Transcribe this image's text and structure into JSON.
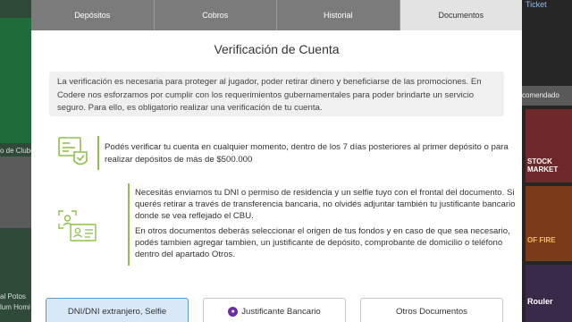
{
  "background": {
    "ticket_label": "Ticket",
    "left_text_top": "o de Clubes",
    "left_text_bottom": [
      "al Potos",
      "lum Homi"
    ],
    "right_rec_label": "comendado",
    "game1_label": "STOCK MARKET",
    "game2_label": "OF FIRE",
    "game3_label": "Rouler"
  },
  "tabs": [
    {
      "label": "Depósitos",
      "active": false
    },
    {
      "label": "Cobros",
      "active": false
    },
    {
      "label": "Historial",
      "active": false
    },
    {
      "label": "Documentos",
      "active": true
    }
  ],
  "title": "Verificación de Cuenta",
  "info_text": "La verificación es necesaria para proteger al jugador, poder retirar dinero y beneficiarse de las promociones. En Codere nos esforzamos por cumplir con los requerimientos gubernamentales para poder brindarte un servicio seguro. Para ello, es obligatorio realizar una verificación de tu cuenta.",
  "block1_text": "Podés verificar tu cuenta en cualquier momento, dentro de los 7 días posteriores al primer depósito o para realizar depósitos de más de $500.000",
  "block2_p1": "Necesitás enviarnos tu DNI o permiso de residencia y un selfie tuyo con el frontal del documento. Si querés retirar a través de transferencia bancaria, no olvidés adjuntar también tu justificante bancario donde se vea reflejado el CBU.",
  "block2_p2": "En otros documentos deberás seleccionar el origen de tus fondos y en caso de que sea necesario, podés tambien agregar tambien, un justificante de depósito, comprobante de domicilio o teléfono dentro del apartado Otros.",
  "buttons": {
    "dni": "DNI/DNI extranjero, Selfie",
    "bank": "Justificante Bancario",
    "other": "Otros Documentos"
  },
  "colors": {
    "accent": "#8fc04b",
    "tab_bg": "#7b7b7b",
    "tab_active_bg": "#e3e3e3",
    "bank_dot": "#6b2fa0"
  },
  "icons": {
    "block1": "verified-document-icon",
    "block2": "id-card-face-scan-icon"
  }
}
